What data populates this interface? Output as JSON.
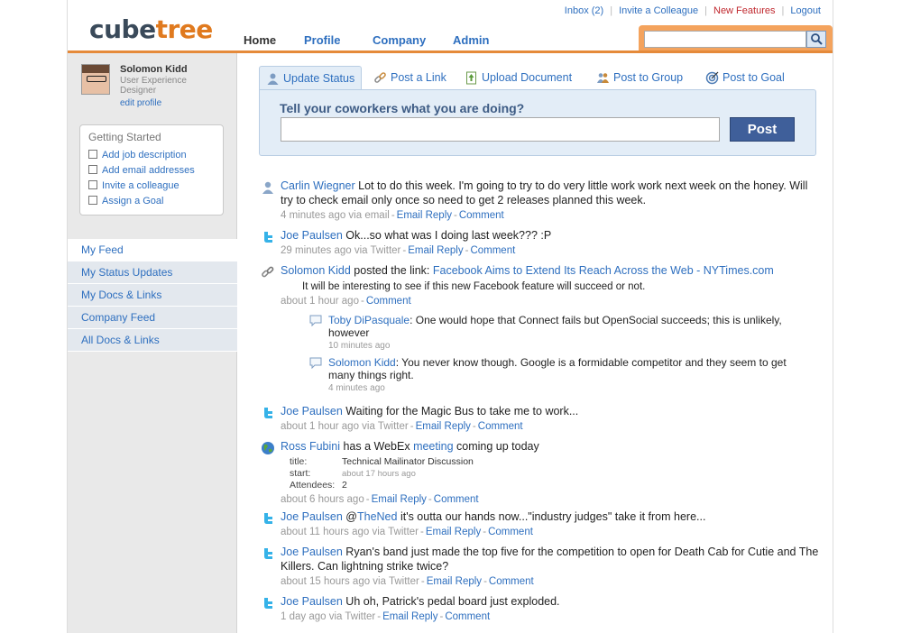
{
  "header": {
    "logo_a": "cube",
    "logo_b": "tree",
    "toplinks": [
      "Inbox (2)",
      "Invite a Colleague",
      "New Features",
      "Logout"
    ],
    "nav": [
      "Home",
      "Profile",
      "Company",
      "Admin"
    ],
    "search_value": ""
  },
  "profile": {
    "name": "Solomon Kidd",
    "title": "User Experience Designer",
    "edit": "edit profile"
  },
  "getting_started": {
    "heading": "Getting Started",
    "items": [
      "Add job description",
      "Add email addresses",
      "Invite a colleague",
      "Assign a Goal"
    ]
  },
  "sidebar_nav": [
    "My Feed",
    "My Status Updates",
    "My Docs & Links",
    "Company Feed",
    "All Docs & Links"
  ],
  "tabs": [
    "Update Status",
    "Post a Link",
    "Upload Document",
    "Post to Group",
    "Post to Goal"
  ],
  "status_panel": {
    "prompt": "Tell your coworkers what you are doing?",
    "input_value": "",
    "post_button": "Post"
  },
  "feed": {
    "links": {
      "email_reply": "Email Reply",
      "comment": "Comment"
    },
    "items": [
      {
        "who": "Carlin Wiegner",
        "text": " Lot to do this week. I'm going to try to do very little work work next week on the honey. Will try to check email only once so need to get 2 releases planned this week.",
        "meta": "4 minutes ago via email",
        "icon": "person-icon"
      },
      {
        "who": "Joe Paulsen",
        "text": " Ok...so what was I doing last week??? :P",
        "meta": "29 minutes ago via Twitter",
        "icon": "twitter-icon"
      },
      {
        "who": "Solomon Kidd",
        "text": " posted the link: ",
        "link": "Facebook Aims to Extend Its Reach Across the Web - NYTimes.com",
        "excerpt": "It will be interesting to see if this new Facebook feature will succeed or not.",
        "meta": "about 1 hour ago",
        "icon": "link-icon",
        "comments": [
          {
            "who": "Toby DiPasquale",
            "text": ": One would hope that Connect fails but OpenSocial succeeds; this is unlikely, however",
            "meta": "10 minutes ago"
          },
          {
            "who": "Solomon Kidd",
            "text": ": You never know though. Google is a formidable competitor and they seem to get many things right.",
            "meta": "4 minutes ago"
          }
        ]
      },
      {
        "who": "Joe Paulsen",
        "text": " Waiting for the Magic Bus to take me to work...",
        "meta": "about 1 hour ago via Twitter",
        "icon": "twitter-icon"
      },
      {
        "who": "Ross Fubini",
        "text_a": " has a WebEx ",
        "link": "meeting",
        "text_b": " coming up today",
        "icon": "globe-icon",
        "meeting": {
          "title_key": "title:",
          "title_val": "Technical Mailinator Discussion",
          "start_key": "start:",
          "start_val": "about 17 hours ago",
          "att_key": "Attendees:",
          "att_val": "2"
        },
        "meta": "about 6 hours ago"
      },
      {
        "who": "Joe Paulsen",
        "text": " @",
        "link": "TheNed",
        "text_b": " it's outta our hands now...\"industry judges\" take it from here...",
        "meta": "about 11 hours ago via Twitter",
        "icon": "twitter-icon"
      },
      {
        "who": "Joe Paulsen",
        "text": " Ryan's band just made the top five for the competition to open for Death Cab for Cutie and The Killers. Can lightning strike twice?",
        "meta": "about 15 hours ago via Twitter",
        "icon": "twitter-icon"
      },
      {
        "who": "Joe Paulsen",
        "text": " Uh oh, Patrick's pedal board just exploded.",
        "meta": "1 day ago via Twitter",
        "icon": "twitter-icon"
      }
    ]
  }
}
